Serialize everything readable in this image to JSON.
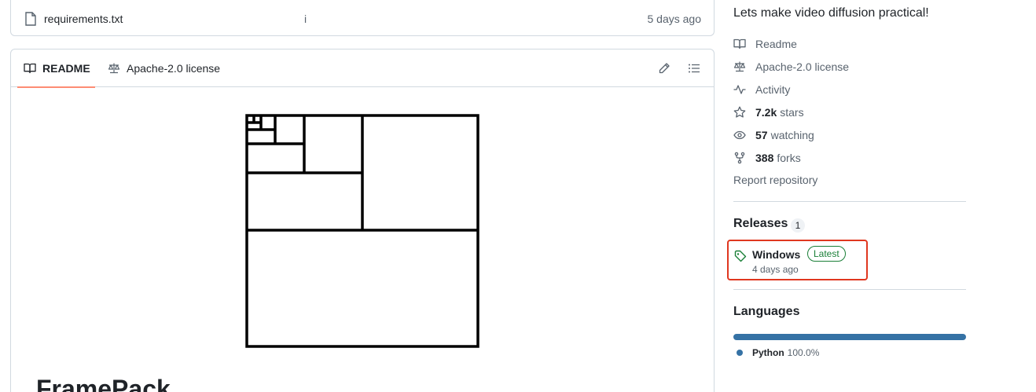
{
  "file_row": {
    "name": "requirements.txt",
    "commit_message": "i",
    "date": "5 days ago"
  },
  "readme": {
    "tabs": [
      {
        "label": "README",
        "icon": "book-icon",
        "active": true
      },
      {
        "label": "Apache-2.0 license",
        "icon": "law-icon",
        "active": false
      }
    ],
    "heading": "FramePack"
  },
  "about": {
    "description": "Lets make video diffusion practical!",
    "links": [
      {
        "icon": "book-icon",
        "label": "Readme"
      },
      {
        "icon": "law-icon",
        "label": "Apache-2.0 license"
      },
      {
        "icon": "pulse-icon",
        "label": "Activity"
      },
      {
        "icon": "star-icon",
        "count": "7.2k",
        "label": "stars"
      },
      {
        "icon": "eye-icon",
        "count": "57",
        "label": "watching"
      },
      {
        "icon": "fork-icon",
        "count": "388",
        "label": "forks"
      }
    ],
    "report": "Report repository"
  },
  "releases": {
    "title": "Releases",
    "count": "1",
    "latest": {
      "name": "Windows",
      "badge": "Latest",
      "date": "4 days ago"
    }
  },
  "languages": {
    "title": "Languages",
    "items": [
      {
        "name": "Python",
        "percent": "100.0%",
        "color": "#3572a5"
      }
    ]
  },
  "colors": {
    "accent_tab": "#fd8c73",
    "highlight": "#e0371f",
    "latest_green": "#1a7f37"
  }
}
